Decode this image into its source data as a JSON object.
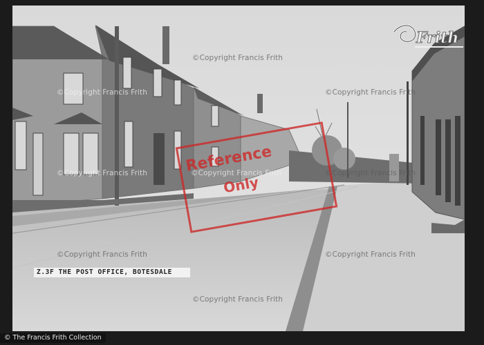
{
  "photo": {
    "alt": "Village street with houses and a post office",
    "caption": "Z.3F  THE POST OFFICE, BOTESDALE"
  },
  "watermarks": {
    "copyright": "©Copyright Francis Frith",
    "reference_line1": "Reference",
    "reference_line2": "Only"
  },
  "logo": {
    "text": "Frith"
  },
  "footer": {
    "copyright": "© The Francis Frith Collection"
  },
  "colors": {
    "reference_red": "#cd2828"
  }
}
